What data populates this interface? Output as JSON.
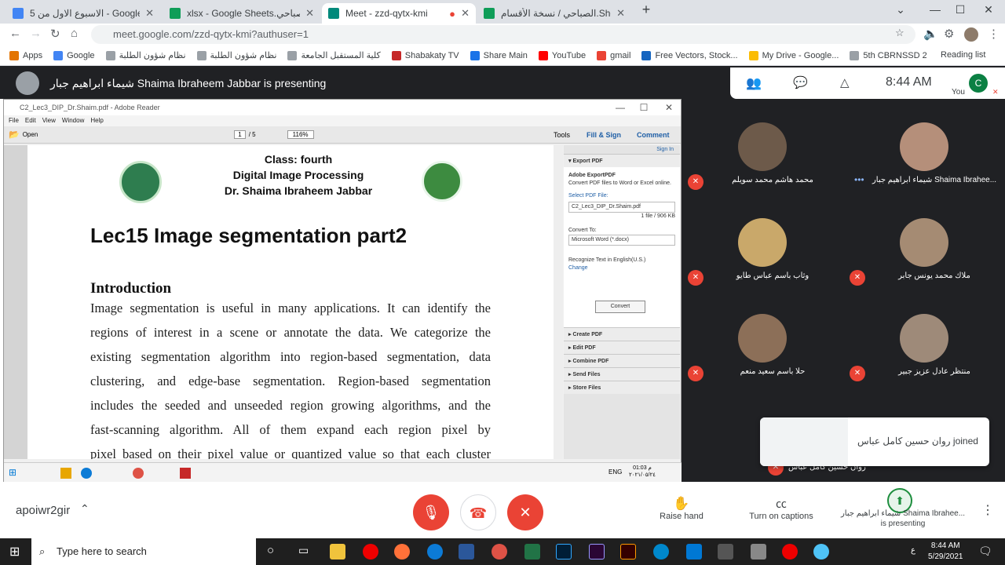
{
  "browser": {
    "tabs": [
      {
        "title": "الاسبوع الاول من 5 - Google Drive",
        "color": "#4285f4"
      },
      {
        "title": "xlsx - Google Sheets.الصباحي",
        "color": "#0f9d58"
      },
      {
        "title": "Meet - zzd-qytx-kmi",
        "color": "#00897b"
      },
      {
        "title": "الصباحي / نسخة الأقسام.Sheets",
        "color": "#0f9d58"
      }
    ],
    "url": "meet.google.com/zzd-qytx-kmi?authuser=1",
    "bookmarks": [
      "Apps",
      "Google",
      "نظام شؤون الطلبة",
      "نظام شؤون الطلبة",
      "كلية المستقبل الجامعة",
      "Shabakaty TV",
      "Share Main",
      "YouTube",
      "gmail",
      "Free Vectors, Stock...",
      "My Drive - Google...",
      "5th CBRNSSD 2020..."
    ],
    "reading_list": "Reading list"
  },
  "meet": {
    "presenting_banner": "شيماء ابراهيم جبار Shaima Ibraheem Jabbar is presenting",
    "time": "8:44  AM",
    "you_label": "You",
    "avatar_letter": "C",
    "meeting_code": "apoiwr2gir",
    "raise_hand": "Raise hand",
    "captions": "Turn on captions",
    "presenter_name": "شيماء ابراهيم جبار Shaima Ibrahee...",
    "presenter_status": "is presenting",
    "toast": "روان حسين كامل عباس joined",
    "participants": [
      {
        "name": "محمد هاشم محمد سويلم",
        "color": "#6d5a4a"
      },
      {
        "name": "شيماء ابراهيم جبار Shaima Ibrahee...",
        "color": "#b58f7a"
      },
      {
        "name": "وثاب باسم عباس طايو",
        "color": "#c9a86a"
      },
      {
        "name": "ملاك محمد يونس جابر",
        "color": "#a58b73"
      },
      {
        "name": "حلا باسم سعيد منعم",
        "color": "#8c6f58"
      },
      {
        "name": "منتظر عادل عزيز جبير",
        "color": "#9e8a79"
      }
    ],
    "partial_participant": "روان حسين كامل عباس"
  },
  "adobe": {
    "window_title": "C2_Lec3_DIP_Dr.Shaim.pdf - Adobe Reader",
    "menu": [
      "File",
      "Edit",
      "View",
      "Window",
      "Help"
    ],
    "open": "Open",
    "page_current": "1",
    "page_total": "/ 5",
    "zoom": "116%",
    "tools": "Tools",
    "fill_sign": "Fill & Sign",
    "comment": "Comment",
    "sign_in": "Sign In",
    "export_pdf": "Export PDF",
    "export_sub": "Adobe ExportPDF",
    "export_desc": "Convert PDF files to Word or Excel online.",
    "select_file": "Select PDF File:",
    "file_name": "C2_Lec3_DIP_Dr.Shaim.pdf",
    "file_info": "1 file / 906 KB",
    "convert_to": "Convert To:",
    "format": "Microsoft Word (*.docx)",
    "recognize": "Recognize Text in English(U.S.)",
    "change": "Change",
    "convert": "Convert",
    "sections": [
      "Create PDF",
      "Edit PDF",
      "Combine PDF",
      "Send Files",
      "Store Files"
    ]
  },
  "pdf": {
    "class": "Class: fourth",
    "course": "Digital Image Processing",
    "author": "Dr. Shaima Ibraheem Jabbar",
    "title": "Lec15 Image segmentation part2",
    "heading": "Introduction",
    "lines": [
      "Image segmentation is useful in many applications. It can identify the",
      "regions of interest in a scene or annotate the data. We categorize the",
      "existing segmentation algorithm into region-based segmentation, data",
      "clustering, and edge-base segmentation. Region-based segmentation",
      "includes the seeded and unseeded region growing algorithms, and the",
      "fast-scanning algorithm. All of them expand each region pixel by",
      "pixel based on their pixel value or quantized value so that each cluster"
    ]
  },
  "innertaskbar": {
    "lang": "ENG",
    "time": "01:03 م",
    "date": "٢٠٢١/٠٥/٢٤"
  },
  "taskbar": {
    "search": "Type here to search",
    "time": "8:44 AM",
    "date": "5/29/2021",
    "lang": "ع"
  }
}
